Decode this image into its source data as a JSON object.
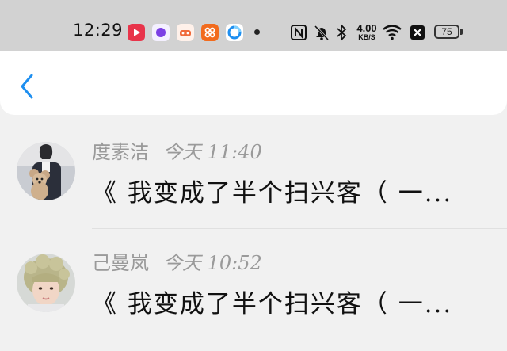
{
  "status_bar": {
    "time": "12:29",
    "app_icons": [
      {
        "icon": "video-app-icon",
        "color": "#e8344a"
      },
      {
        "icon": "circle-app-icon",
        "color": "#7b3fe4"
      },
      {
        "icon": "game-app-icon",
        "color": "#f06a3a"
      },
      {
        "icon": "grid-app-icon",
        "color": "#f26b1d"
      },
      {
        "icon": "browser-app-icon",
        "color": "#1e8ff0"
      }
    ],
    "net_speed_value": "4.00",
    "net_speed_unit": "KB/S",
    "battery": "75"
  },
  "header": {
    "back_icon": "chevron-left-icon",
    "accent": "#1e8ff0"
  },
  "messages": [
    {
      "name": "度素洁",
      "time": "今天 11:40",
      "text": "《 我变成了半个扫兴客（ 一...",
      "avatar": "avatar-bear-girl"
    },
    {
      "name": "己曼岚",
      "time": "今天 10:52",
      "text": "《 我变成了半个扫兴客（ 一...",
      "avatar": "avatar-curly-boy"
    }
  ]
}
